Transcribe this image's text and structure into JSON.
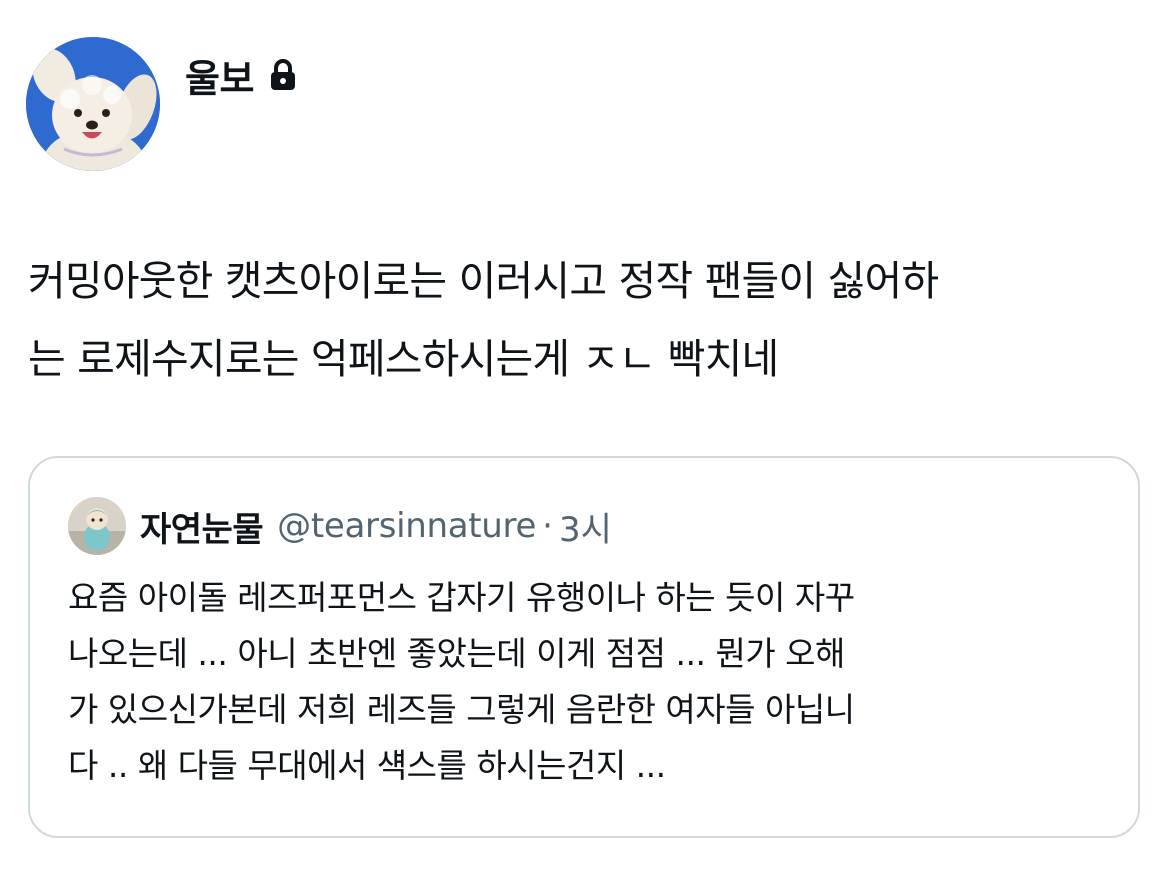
{
  "tweet": {
    "author": {
      "name": "울보",
      "avatar_icon": "fluffy-white-dog-avatar",
      "protected_icon": "lock-icon"
    },
    "text_lines": [
      "커밍아웃한 캣츠아이로는 이러시고 정작 팬들이 싫어하",
      "는 로제수지로는 억페스하시는게 ㅈㄴ 빡치네"
    ]
  },
  "quote": {
    "author": {
      "name": "자연눈물",
      "handle": "@tearsinnature",
      "separator": "·",
      "time": "3시",
      "avatar_icon": "plush-doll-avatar"
    },
    "text_lines": [
      "요즘 아이돌 레즈퍼포먼스 갑자기 유행이나 하는 듯이 자꾸",
      "나오는데 ... 아니 초반엔 좋았는데 이게 점점 ... 뭔가 오해",
      "가 있으신가본데 저희 레즈들 그렇게 음란한 여자들 아닙니",
      "다 .. 왜 다들 무대에서 섁스를 하시는건지 ..."
    ]
  },
  "colors": {
    "text_primary": "#0f1419",
    "text_secondary": "#536471",
    "border": "#cfd9de",
    "avatar_background": "#2f6ad0"
  }
}
